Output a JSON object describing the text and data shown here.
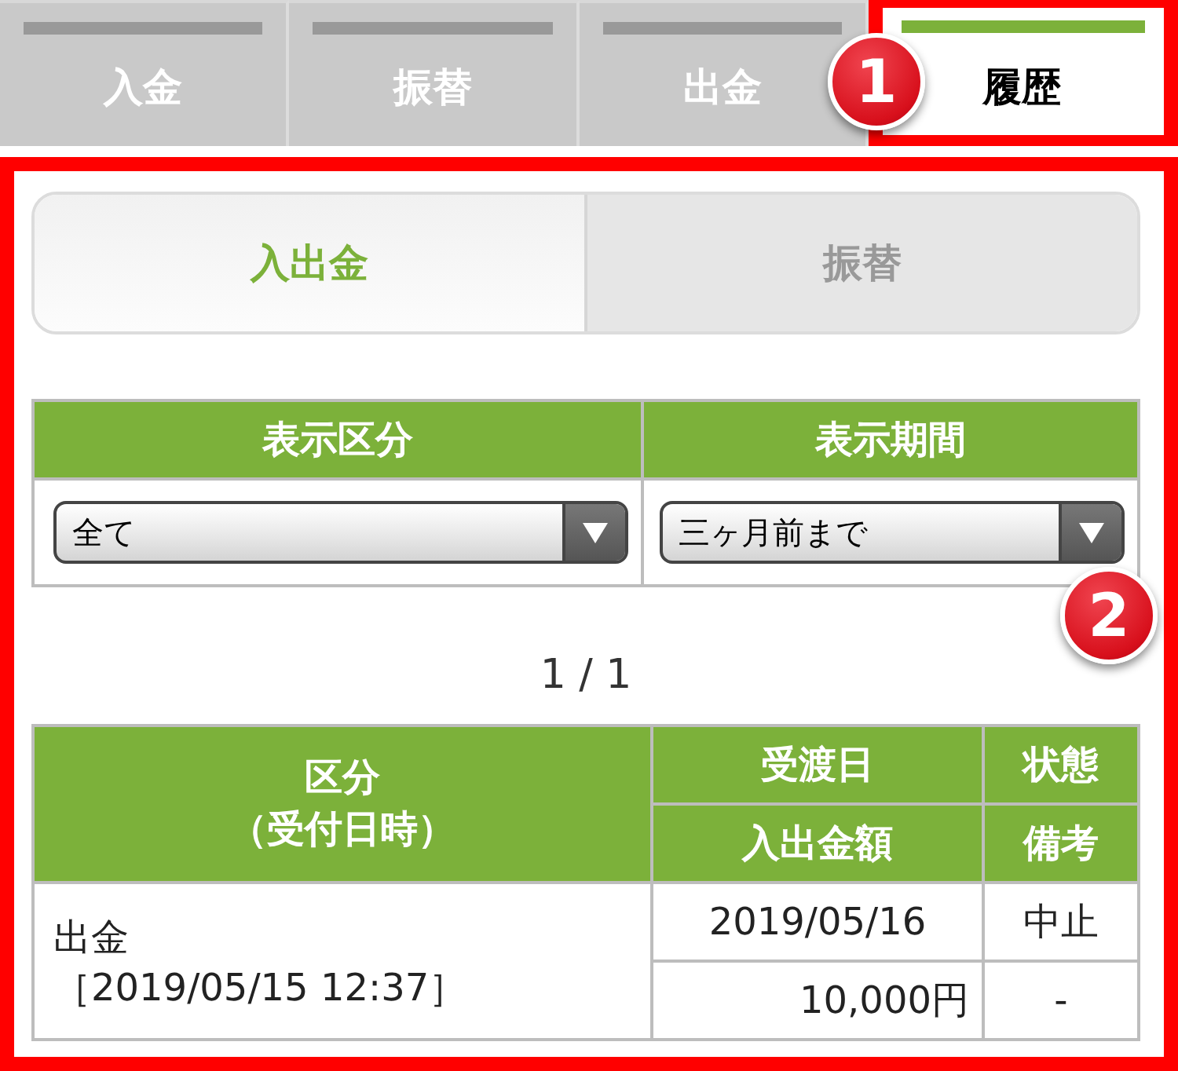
{
  "tabs": [
    {
      "label": "入金",
      "selected": false,
      "highlighted": false
    },
    {
      "label": "振替",
      "selected": false,
      "highlighted": false
    },
    {
      "label": "出金",
      "selected": false,
      "highlighted": false
    },
    {
      "label": "履歴",
      "selected": true,
      "highlighted": true
    }
  ],
  "callouts": [
    {
      "label": "1"
    },
    {
      "label": "2"
    }
  ],
  "history_panel": {
    "highlighted": true,
    "segments": [
      {
        "label": "入出金",
        "selected": true
      },
      {
        "label": "振替",
        "selected": false
      }
    ],
    "filters": [
      {
        "label": "表示区分",
        "value": "全て"
      },
      {
        "label": "表示期間",
        "value": "三ヶ月前まで"
      }
    ],
    "pagination": "1 / 1",
    "table": {
      "columns": [
        {
          "label_lines": [
            "区分",
            "（受付日時）"
          ]
        },
        {
          "label": "受渡日",
          "sub_label": "入出金額"
        },
        {
          "label": "状態",
          "sub_label": "備考"
        }
      ],
      "rows": [
        {
          "category": "出金",
          "received_at": "［2019/05/15 12:37］",
          "delivery_date": "2019/05/16",
          "amount": "10,000円",
          "status": "中止",
          "note": "-"
        }
      ]
    }
  }
}
